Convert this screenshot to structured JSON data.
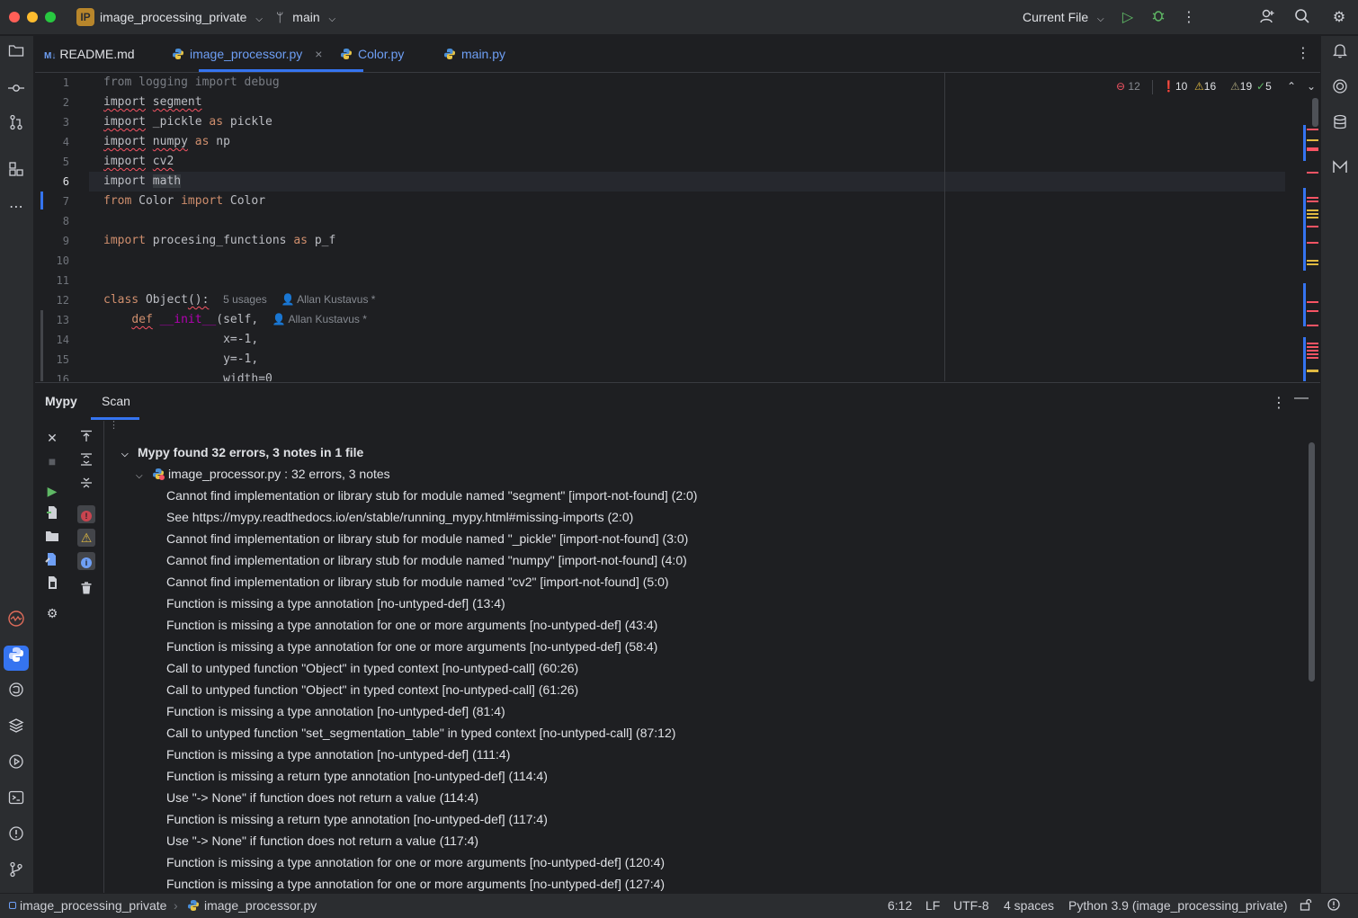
{
  "titlebar": {
    "project_badge": "IP",
    "project_name": "image_processing_private",
    "branch": "main",
    "run_config": "Current File"
  },
  "tabs": [
    {
      "label": "README.md",
      "icon": "markdown-icon"
    },
    {
      "label": "image_processor.py",
      "icon": "python-file-icon",
      "active": true
    },
    {
      "label": "Color.py",
      "icon": "python-file-icon"
    },
    {
      "label": "main.py",
      "icon": "python-file-icon"
    }
  ],
  "inspections": {
    "blocked": "12",
    "errors": "10",
    "warnings": "16",
    "weak_warnings": "19",
    "ok": "5"
  },
  "editor": {
    "line_numbers": [
      "1",
      "2",
      "3",
      "4",
      "5",
      "6",
      "7",
      "8",
      "9",
      "10",
      "11",
      "12",
      "13",
      "14",
      "15",
      "16"
    ],
    "lines": {
      "l1": "from logging import debug",
      "l2a": "import",
      "l2b": "segment",
      "l3a": "import",
      "l3b": "_pickle",
      "l3c": "as",
      "l3d": "pickle",
      "l4a": "import",
      "l4b": "numpy",
      "l4c": "as",
      "l4d": "np",
      "l5a": "import",
      "l5b": "cv2",
      "l6a": "import",
      "l6b": "math",
      "l7a": "from",
      "l7b": "Color",
      "l7c": "import",
      "l7d": "Color",
      "l9a": "import",
      "l9b": "procesing_functions",
      "l9c": "as",
      "l9d": "p_f",
      "l12a": "class",
      "l12b": "Object",
      "l12c": "():",
      "l13a": "def",
      "l13b": "__init__",
      "l13c": "(self,",
      "l14": "x=-1,",
      "l15": "y=-1,",
      "l16": "width=0"
    },
    "hints": {
      "class_usages": "5 usages",
      "class_author": "Allan Kustavus *",
      "init_author": "Allan Kustavus *"
    }
  },
  "toolwindow": {
    "tabs": [
      "Mypy",
      "Scan"
    ],
    "active_tab": "Scan",
    "summary": "Mypy found 32 errors, 3 notes  in 1 file",
    "file_node": "image_processor.py : 32 errors, 3 notes",
    "results": [
      "Cannot find implementation or library stub for module named \"segment\"  [import-not-found] (2:0)",
      "See https://mypy.readthedocs.io/en/stable/running_mypy.html#missing-imports (2:0)",
      "Cannot find implementation or library stub for module named \"_pickle\"  [import-not-found] (3:0)",
      "Cannot find implementation or library stub for module named \"numpy\"  [import-not-found] (4:0)",
      "Cannot find implementation or library stub for module named \"cv2\"  [import-not-found] (5:0)",
      "Function is missing a type annotation  [no-untyped-def] (13:4)",
      "Function is missing a type annotation for one or more arguments  [no-untyped-def] (43:4)",
      "Function is missing a type annotation for one or more arguments  [no-untyped-def] (58:4)",
      "Call to untyped function \"Object\" in typed context  [no-untyped-call] (60:26)",
      "Call to untyped function \"Object\" in typed context  [no-untyped-call] (61:26)",
      "Function is missing a type annotation  [no-untyped-def] (81:4)",
      "Call to untyped function \"set_segmentation_table\" in typed context  [no-untyped-call] (87:12)",
      "Function is missing a type annotation  [no-untyped-def] (111:4)",
      "Function is missing a return type annotation  [no-untyped-def] (114:4)",
      "Use \"-> None\" if function does not return a value (114:4)",
      "Function is missing a return type annotation  [no-untyped-def] (117:4)",
      "Use \"-> None\" if function does not return a value (117:4)",
      "Function is missing a type annotation for one or more arguments  [no-untyped-def] (120:4)",
      "Function is missing a type annotation for one or more arguments  [no-untyped-def] (127:4)"
    ]
  },
  "statusbar": {
    "project": "image_processing_private",
    "file": "image_processor.py",
    "position": "6:12",
    "line_sep": "LF",
    "encoding": "UTF-8",
    "indent": "4 spaces",
    "interpreter": "Python 3.9 (image_processing_private)"
  },
  "colors": {
    "accent": "#3574f0",
    "error": "#f75464",
    "warning": "#e0b941",
    "ok": "#5fb865"
  }
}
